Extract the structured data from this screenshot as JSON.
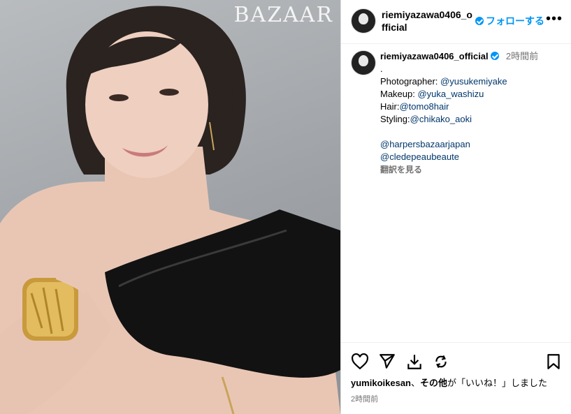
{
  "photo": {
    "brand": "BAZAAR"
  },
  "header": {
    "username": "riemiyazawa0406_official",
    "follow_label": "フォローする",
    "more_label": "•••"
  },
  "caption": {
    "username": "riemiyazawa0406_official",
    "time": "2時間前",
    "dot": ".",
    "lines": [
      {
        "label": "Photographer: ",
        "handle": "@yusukemiyake"
      },
      {
        "label": "Makeup: ",
        "handle": "@yuka_washizu"
      },
      {
        "label": "Hair:",
        "handle": "@tomo8hair"
      },
      {
        "label": "Styling:",
        "handle": "@chikako_aoki"
      }
    ],
    "tags": [
      "@harpersbazaarjapan",
      "@cledepeaubeaute"
    ],
    "translate": "翻訳を見る"
  },
  "actions": {
    "like_icon": "heart-icon",
    "comment_icon": "comment-icon",
    "share_icon": "share-icon",
    "save_icon": "bookmark-icon",
    "download_icon": "download-icon",
    "repost_icon": "repost-icon"
  },
  "likes": {
    "user": "yumikoikesan",
    "sep": "、",
    "others": "その他",
    "suffix": "が「いいね！」しました"
  },
  "post_time": "2時間前",
  "colors": {
    "accent": "#0095f6",
    "link": "#00376b",
    "muted": "#737373"
  }
}
